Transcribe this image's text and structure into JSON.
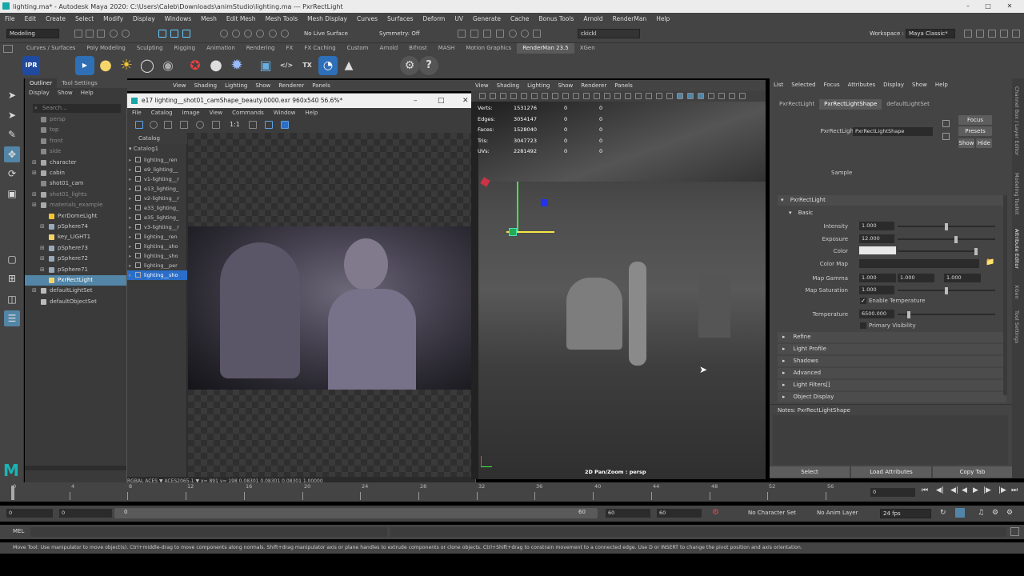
{
  "window": {
    "title": "lighting.ma* - Autodesk Maya 2020: C:\\Users\\Caleb\\Downloads\\animStudio\\lighting.ma   ---   PxrRectLight"
  },
  "menubar": [
    "File",
    "Edit",
    "Create",
    "Select",
    "Modify",
    "Display",
    "Windows",
    "Mesh",
    "Edit Mesh",
    "Mesh Tools",
    "Mesh Display",
    "Curves",
    "Surfaces",
    "Deform",
    "UV",
    "Generate",
    "Cache",
    "Bonus Tools",
    "Arnold",
    "RenderMan",
    "Help"
  ],
  "workspace": {
    "label": "Workspace :",
    "value": "Maya Classic*"
  },
  "statusline": {
    "mode": "Modeling",
    "live_surface": "No Live Surface",
    "symmetry": "Symmetry: Off",
    "user": "ckickl"
  },
  "shelf": {
    "tabs": [
      "Curves / Surfaces",
      "Poly Modeling",
      "Sculpting",
      "Rigging",
      "Animation",
      "Rendering",
      "FX",
      "FX Caching",
      "Custom",
      "Arnold",
      "Bifrost",
      "MASH",
      "Motion Graphics",
      "RenderMan 23.5",
      "XGen"
    ],
    "active_tab": "RenderMan 23.5",
    "icons": [
      "ipr-render-icon",
      "render-icon",
      "sun-light-icon",
      "dome-light-icon",
      "rect-light-icon",
      "env-light-icon",
      "star-light-icon",
      "sphere-light-icon",
      "gear-material-icon",
      "cube-material-icon",
      "code-icon",
      "tx-icon",
      "water-icon",
      "mountain-icon",
      "settings-icon",
      "help-icon"
    ],
    "icon_text": {
      "ipr": "IPR",
      "tx": "TX"
    }
  },
  "outliner": {
    "tabs": [
      "Outliner",
      "Tool Settings"
    ],
    "menu": [
      "Display",
      "Show",
      "Help"
    ],
    "search_placeholder": "Search...",
    "items": [
      {
        "label": "persp",
        "indent": 0,
        "dim": true,
        "icon": "camera"
      },
      {
        "label": "top",
        "indent": 0,
        "dim": true,
        "icon": "camera"
      },
      {
        "label": "front",
        "indent": 0,
        "dim": true,
        "icon": "camera"
      },
      {
        "label": "side",
        "indent": 0,
        "dim": true,
        "icon": "camera"
      },
      {
        "label": "character",
        "indent": 0,
        "dim": false,
        "icon": "group",
        "expand": true
      },
      {
        "label": "cabin",
        "indent": 0,
        "dim": false,
        "icon": "group",
        "expand": true
      },
      {
        "label": "shot01_cam",
        "indent": 0,
        "dim": false,
        "icon": "camera"
      },
      {
        "label": "shot01_lights",
        "indent": 0,
        "dim": true,
        "icon": "group",
        "expand": true
      },
      {
        "label": "materials_example",
        "indent": 0,
        "dim": true,
        "icon": "group",
        "expand": true
      },
      {
        "label": "PxrDomeLight",
        "indent": 1,
        "dim": false,
        "icon": "sun"
      },
      {
        "label": "pSphere74",
        "indent": 1,
        "dim": false,
        "icon": "sphere",
        "expand": true
      },
      {
        "label": "key_LIGHT1",
        "indent": 1,
        "dim": false,
        "icon": "rect"
      },
      {
        "label": "pSphere73",
        "indent": 1,
        "dim": false,
        "icon": "sphere",
        "expand": true
      },
      {
        "label": "pSphere72",
        "indent": 1,
        "dim": false,
        "icon": "sphere",
        "expand": true
      },
      {
        "label": "pSphere71",
        "indent": 1,
        "dim": false,
        "icon": "sphere",
        "expand": true
      },
      {
        "label": "PxrRectLight",
        "indent": 1,
        "dim": false,
        "icon": "rect",
        "selected": true
      },
      {
        "label": "defaultLightSet",
        "indent": 0,
        "dim": false,
        "icon": "set",
        "expand": true
      },
      {
        "label": "defaultObjectSet",
        "indent": 0,
        "dim": false,
        "icon": "set"
      }
    ]
  },
  "viewport_left_menu": [
    "View",
    "Shading",
    "Lighting",
    "Show",
    "Renderer",
    "Panels"
  ],
  "render_view": {
    "title": "e17 lighting__shot01_camShape_beauty.0000.exr 960x540 56.6%*",
    "menu": [
      "File",
      "Catalog",
      "Image",
      "View",
      "Commands",
      "Window",
      "Help"
    ],
    "catalog_label": "Catalog",
    "catalog_root": "Catalog1",
    "catalog_items": [
      "lighting__ren",
      "e9_lighting__",
      "v1-lighting__r",
      "e13_lighting_",
      "v2-lighting__r",
      "e33_lighting_",
      "e35_lighting_",
      "v3-lighting__r",
      "lighting__ren",
      "lighting__sho",
      "lighting__sho",
      "lighting__per",
      "lighting__sho"
    ],
    "status": "RGBAL  ACES ▼  ACES2065-1 ▼  x= 891  y= 198  0.08301  0.08301  0.08301  1.00000"
  },
  "viewport": {
    "menu": [
      "View",
      "Shading",
      "Lighting",
      "Show",
      "Renderer",
      "Panels"
    ],
    "hud": [
      {
        "label": "Verts:",
        "v1": "1531276",
        "v2": "0",
        "v3": "0"
      },
      {
        "label": "Edges:",
        "v1": "3054147",
        "v2": "0",
        "v3": "0"
      },
      {
        "label": "Faces:",
        "v1": "1528040",
        "v2": "0",
        "v3": "0"
      },
      {
        "label": "Tris:",
        "v1": "3047723",
        "v2": "0",
        "v3": "0"
      },
      {
        "label": "UVs:",
        "v1": "2281492",
        "v2": "0",
        "v3": "0"
      }
    ],
    "camera_label": "2D Pan/Zoom : persp"
  },
  "attribute_editor": {
    "menu": [
      "List",
      "Selected",
      "Focus",
      "Attributes",
      "Display",
      "Show",
      "Help"
    ],
    "tabs": [
      "PxrRectLight",
      "PxrRectLightShape",
      "defaultLightSet"
    ],
    "active_tab": "PxrRectLightShape",
    "node_label": "PxrRectLight:",
    "node_value": "PxrRectLightShape",
    "buttons": {
      "focus": "Focus",
      "presets": "Presets",
      "show": "Show",
      "hide": "Hide"
    },
    "sample": "Sample",
    "section_main": "PxrRectLight",
    "section_basic": "Basic",
    "attrs": {
      "intensity": {
        "label": "Intensity",
        "value": "1.000",
        "level": 0.5
      },
      "exposure": {
        "label": "Exposure",
        "value": "12.000",
        "level": 0.6
      },
      "color": {
        "label": "Color"
      },
      "color_map": {
        "label": "Color Map"
      },
      "map_gamma": {
        "label": "Map Gamma",
        "v1": "1.000",
        "v2": "1.000",
        "v3": "1.000"
      },
      "map_saturation": {
        "label": "Map Saturation",
        "value": "1.000",
        "level": 0.5
      },
      "enable_temperature": {
        "label": "Enable Temperature",
        "checked": true
      },
      "temperature": {
        "label": "Temperature",
        "value": "6500.000",
        "level": 0.1
      },
      "primary_visibility": {
        "label": "Primary Visibility",
        "checked": false
      }
    },
    "collapsed_sections": [
      "Refine",
      "Light Profile",
      "Shadows",
      "Advanced",
      "Light Filters[]",
      "Object Display"
    ],
    "notes": "Notes:  PxrRectLightShape",
    "bottom_buttons": [
      "Select",
      "Load Attributes",
      "Copy Tab"
    ]
  },
  "right_tabs": [
    "Channel Box / Layer Editor",
    "Modeling Toolkit",
    "Attribute Editor",
    "XGen",
    "Tool Settings"
  ],
  "timeline": {
    "ticks": [
      "0",
      "4",
      "8",
      "12",
      "16",
      "20",
      "24",
      "28",
      "32",
      "36",
      "40",
      "44",
      "48",
      "52",
      "56"
    ],
    "current_frame": "0",
    "range_start": "0",
    "range_inner_start": "0",
    "range_slider_start": "0",
    "range_slider_end": "60",
    "range_end": "60",
    "range_outer_end": "60",
    "character_set": "No Character Set",
    "anim_layer": "No Anim Layer",
    "fps": "24 fps"
  },
  "command_line": {
    "label": "MEL"
  },
  "help_line": "Move Tool: Use manipulator to move object(s). Ctrl+middle-drag to move components along normals. Shift+drag manipulator axis or plane handles to extrude components or clone objects. Ctrl+Shift+drag to constrain movement to a connected edge. Use D or INSERT to change the pivot position and axis orientation.",
  "colors": {
    "selection": "#5285a6",
    "accent_blue": "#2b6ec9",
    "maya_bg": "#444444",
    "renderman_red": "#d9302c"
  }
}
